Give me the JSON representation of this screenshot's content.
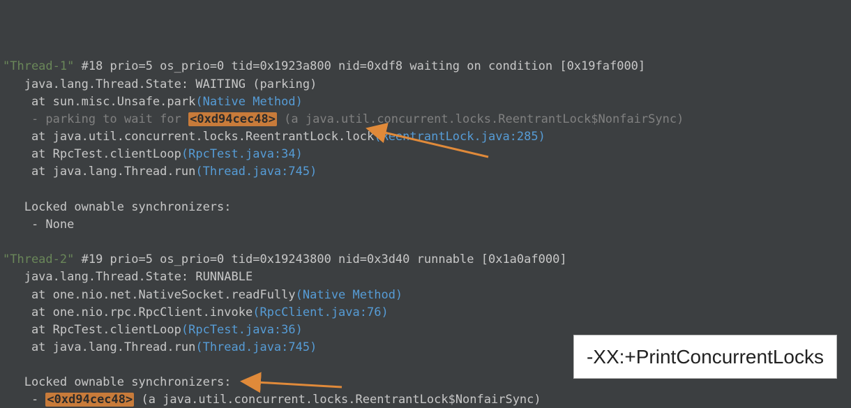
{
  "flag": "-XX:+PrintConcurrentLocks",
  "t1": {
    "name": "\"Thread-1\"",
    "header_rest": " #18 prio=5 os_prio=0 tid=0x1923a800 nid=0xdf8 waiting on condition [0x19faf000]",
    "state_line": "   java.lang.Thread.State: WAITING (parking)",
    "f0": {
      "pre": "    at sun.misc.Unsafe.park",
      "link": "(Native Method)"
    },
    "parking": {
      "pre": "    - parking to wait for ",
      "lock": "<0xd94cec48>",
      "post": " (a java.util.concurrent.locks.ReentrantLock$NonfairSync)"
    },
    "f1": {
      "pre": "    at java.util.concurrent.locks.ReentrantLock.lock",
      "link": "(ReentrantLock.java:285)"
    },
    "f2": {
      "pre": "    at RpcTest.clientLoop",
      "link": "(RpcTest.java:34)"
    },
    "f3": {
      "pre": "    at java.lang.Thread.run",
      "link": "(Thread.java:745)"
    },
    "own_header": "   Locked ownable synchronizers:",
    "own_none": "    - None"
  },
  "t2": {
    "name": "\"Thread-2\"",
    "header_rest": " #19 prio=5 os_prio=0 tid=0x19243800 nid=0x3d40 runnable [0x1a0af000]",
    "state_line": "   java.lang.Thread.State: RUNNABLE",
    "f0": {
      "pre": "    at one.nio.net.NativeSocket.readFully",
      "link": "(Native Method)"
    },
    "f1": {
      "pre": "    at one.nio.rpc.RpcClient.invoke",
      "link": "(RpcClient.java:76)"
    },
    "f2": {
      "pre": "    at RpcTest.clientLoop",
      "link": "(RpcTest.java:36)"
    },
    "f3": {
      "pre": "    at java.lang.Thread.run",
      "link": "(Thread.java:745)"
    },
    "own_header": "   Locked ownable synchronizers:",
    "own_pre": "    - ",
    "own_lock": "<0xd94cec48>",
    "own_post": " (a java.util.concurrent.locks.ReentrantLock$NonfairSync)"
  }
}
